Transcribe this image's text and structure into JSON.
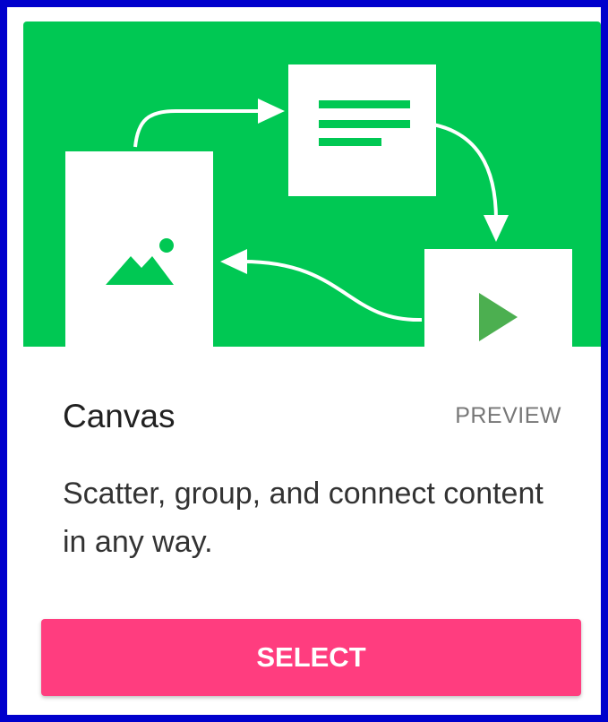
{
  "card": {
    "title": "Canvas",
    "badge": "PREVIEW",
    "description": "Scatter, group, and connect content in any way.",
    "select_label": "SELECT"
  },
  "illustration": {
    "icons": [
      "image-icon",
      "document-text-icon",
      "play-icon"
    ]
  },
  "colors": {
    "frame": "#0000cc",
    "hero_background": "#00c853",
    "select_button": "#ff3d7f",
    "play_triangle": "#4caf50"
  }
}
